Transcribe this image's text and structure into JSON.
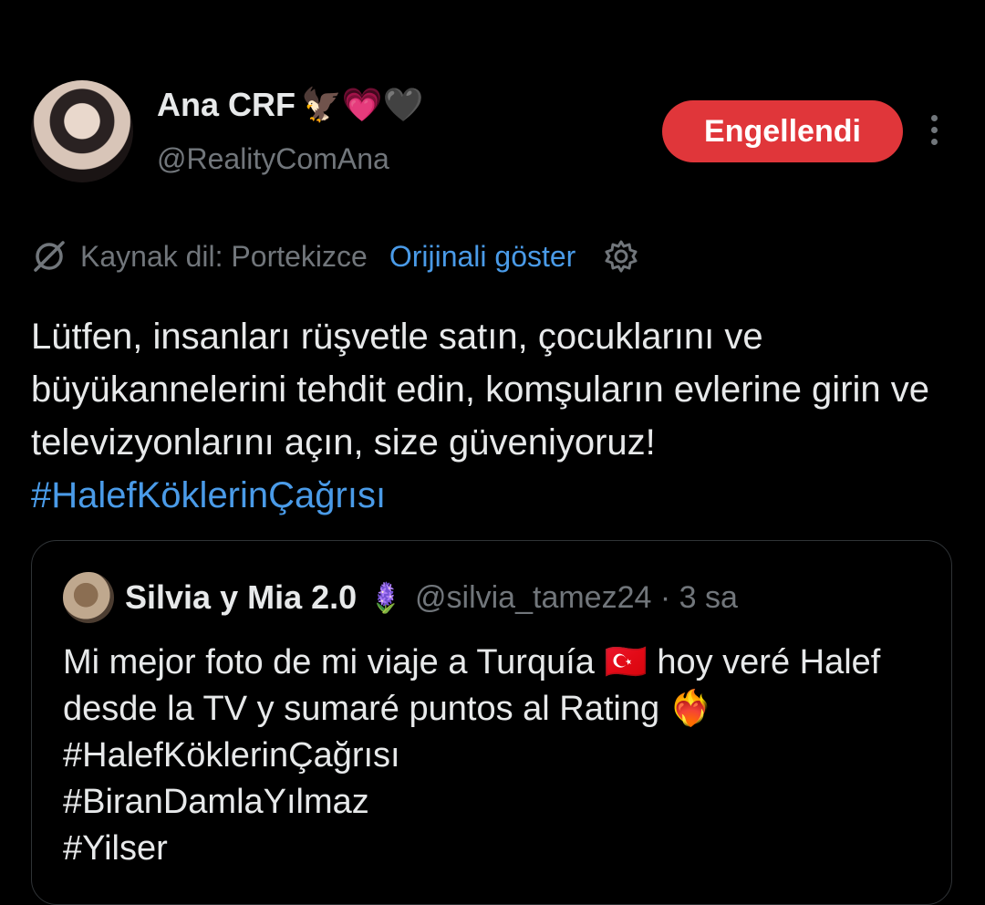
{
  "author": {
    "display_name": "Ana CRF",
    "badges": "🦅💗🖤",
    "handle": "@RealityComAna"
  },
  "actions": {
    "blocked_label": "Engellendi",
    "more_icon": "more-vertical-icon"
  },
  "translation": {
    "source_label": "Kaynak dil: Portekizce",
    "show_original_label": "Orijinali göster",
    "no_icon": "translate-off-icon",
    "settings_icon": "gear-icon"
  },
  "tweet": {
    "text": "Lütfen, insanları rüşvetle satın, çocuklarını ve büyükannelerini tehdit edin, komşuların evlerine girin ve televizyonlarını açın, size güveniyoruz! ",
    "hashtag": "#HalefKöklerinÇağrısı"
  },
  "quoted": {
    "display_name": "Silvia y Mia 2.0",
    "emoji": "🪻",
    "handle_time": "@silvia_tamez24 · 3 sa",
    "text": "Mi mejor foto de mi viaje a Turquía 🇹🇷 hoy veré Halef desde la TV y sumaré puntos al Rating ❤️‍🔥\n#HalefKöklerinÇağrısı\n#BiranDamlaYılmaz\n#Yilser"
  },
  "colors": {
    "background": "#000000",
    "text": "#e7e9ea",
    "muted": "#71767b",
    "link": "#4a9be8",
    "blocked": "#e0363a"
  }
}
